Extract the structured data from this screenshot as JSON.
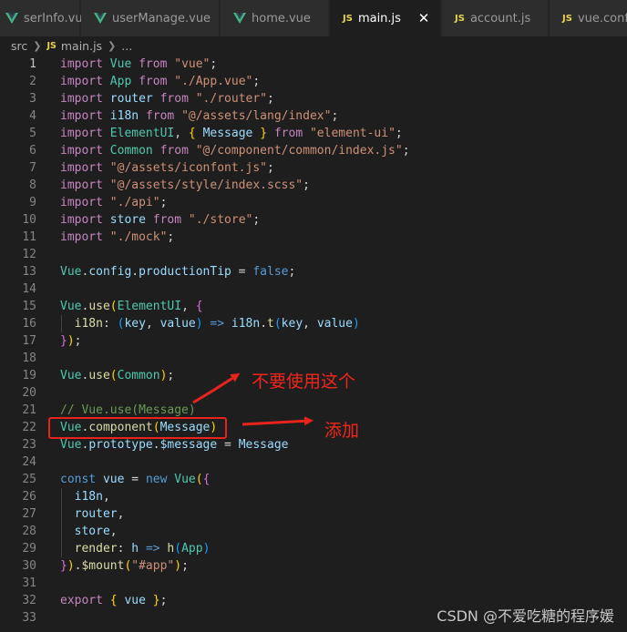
{
  "tabs": [
    {
      "label": "serInfo.vue",
      "icon": "vue-icon",
      "active": false
    },
    {
      "label": "userManage.vue",
      "icon": "vue-icon",
      "active": false
    },
    {
      "label": "home.vue",
      "icon": "vue-icon",
      "active": false
    },
    {
      "label": "main.js",
      "icon": "js-icon",
      "active": true
    },
    {
      "label": "account.js",
      "icon": "js-icon",
      "active": false
    },
    {
      "label": "vue.confi",
      "icon": "js-icon",
      "active": false
    }
  ],
  "js_badge": "JS",
  "close_glyph": "✕",
  "breadcrumb": {
    "folder": "src",
    "file": "main.js",
    "more": "..."
  },
  "line_numbers": [
    "1",
    "2",
    "3",
    "4",
    "5",
    "6",
    "7",
    "8",
    "9",
    "10",
    "11",
    "12",
    "13",
    "14",
    "15",
    "16",
    "17",
    "18",
    "19",
    "20",
    "21",
    "22",
    "23",
    "24",
    "25",
    "26",
    "27",
    "28",
    "29",
    "30",
    "31",
    "32",
    "33"
  ],
  "current_line": 1,
  "code_lines": [
    [
      [
        "kw",
        "import"
      ],
      [
        "pun",
        " "
      ],
      [
        "cls",
        "Vue"
      ],
      [
        "pun",
        " "
      ],
      [
        "kw",
        "from"
      ],
      [
        "pun",
        " "
      ],
      [
        "str",
        "\"vue\""
      ],
      [
        "pun",
        ";"
      ]
    ],
    [
      [
        "kw",
        "import"
      ],
      [
        "pun",
        " "
      ],
      [
        "cls",
        "App"
      ],
      [
        "pun",
        " "
      ],
      [
        "kw",
        "from"
      ],
      [
        "pun",
        " "
      ],
      [
        "str",
        "\"./App.vue\""
      ],
      [
        "pun",
        ";"
      ]
    ],
    [
      [
        "kw",
        "import"
      ],
      [
        "pun",
        " "
      ],
      [
        "ident",
        "router"
      ],
      [
        "pun",
        " "
      ],
      [
        "kw",
        "from"
      ],
      [
        "pun",
        " "
      ],
      [
        "str",
        "\"./router\""
      ],
      [
        "pun",
        ";"
      ]
    ],
    [
      [
        "kw",
        "import"
      ],
      [
        "pun",
        " "
      ],
      [
        "ident",
        "i18n"
      ],
      [
        "pun",
        " "
      ],
      [
        "kw",
        "from"
      ],
      [
        "pun",
        " "
      ],
      [
        "str",
        "\"@/assets/lang/index\""
      ],
      [
        "pun",
        ";"
      ]
    ],
    [
      [
        "kw",
        "import"
      ],
      [
        "pun",
        " "
      ],
      [
        "cls",
        "ElementUI"
      ],
      [
        "pun",
        ", "
      ],
      [
        "br1",
        "{"
      ],
      [
        "pun",
        " "
      ],
      [
        "ident",
        "Message"
      ],
      [
        "pun",
        " "
      ],
      [
        "br1",
        "}"
      ],
      [
        "pun",
        " "
      ],
      [
        "kw",
        "from"
      ],
      [
        "pun",
        " "
      ],
      [
        "str",
        "\"element-ui\""
      ],
      [
        "pun",
        ";"
      ]
    ],
    [
      [
        "kw",
        "import"
      ],
      [
        "pun",
        " "
      ],
      [
        "cls",
        "Common"
      ],
      [
        "pun",
        " "
      ],
      [
        "kw",
        "from"
      ],
      [
        "pun",
        " "
      ],
      [
        "str",
        "\"@/component/common/index.js\""
      ],
      [
        "pun",
        ";"
      ]
    ],
    [
      [
        "kw",
        "import"
      ],
      [
        "pun",
        " "
      ],
      [
        "str",
        "\"@/assets/iconfont.js\""
      ],
      [
        "pun",
        ";"
      ]
    ],
    [
      [
        "kw",
        "import"
      ],
      [
        "pun",
        " "
      ],
      [
        "str",
        "\"@/assets/style/index.scss\""
      ],
      [
        "pun",
        ";"
      ]
    ],
    [
      [
        "kw",
        "import"
      ],
      [
        "pun",
        " "
      ],
      [
        "str",
        "\"./api\""
      ],
      [
        "pun",
        ";"
      ]
    ],
    [
      [
        "kw",
        "import"
      ],
      [
        "pun",
        " "
      ],
      [
        "ident",
        "store"
      ],
      [
        "pun",
        " "
      ],
      [
        "kw",
        "from"
      ],
      [
        "pun",
        " "
      ],
      [
        "str",
        "\"./store\""
      ],
      [
        "pun",
        ";"
      ]
    ],
    [
      [
        "kw",
        "import"
      ],
      [
        "pun",
        " "
      ],
      [
        "str",
        "\"./mock\""
      ],
      [
        "pun",
        ";"
      ]
    ],
    [],
    [
      [
        "cls",
        "Vue"
      ],
      [
        "pun",
        "."
      ],
      [
        "ident",
        "config"
      ],
      [
        "pun",
        "."
      ],
      [
        "ident",
        "productionTip"
      ],
      [
        "pun",
        " = "
      ],
      [
        "const",
        "false"
      ],
      [
        "pun",
        ";"
      ]
    ],
    [],
    [
      [
        "cls",
        "Vue"
      ],
      [
        "pun",
        "."
      ],
      [
        "fn",
        "use"
      ],
      [
        "br1",
        "("
      ],
      [
        "cls",
        "ElementUI"
      ],
      [
        "pun",
        ", "
      ],
      [
        "br2",
        "{"
      ]
    ],
    [
      [
        "pun",
        "  "
      ],
      [
        "fn",
        "i18n"
      ],
      [
        "pun",
        ": "
      ],
      [
        "br3",
        "("
      ],
      [
        "ident",
        "key"
      ],
      [
        "pun",
        ", "
      ],
      [
        "ident",
        "value"
      ],
      [
        "br3",
        ")"
      ],
      [
        "pun",
        " "
      ],
      [
        "const",
        "=>"
      ],
      [
        "pun",
        " "
      ],
      [
        "ident",
        "i18n"
      ],
      [
        "pun",
        "."
      ],
      [
        "fn",
        "t"
      ],
      [
        "br3",
        "("
      ],
      [
        "ident",
        "key"
      ],
      [
        "pun",
        ", "
      ],
      [
        "ident",
        "value"
      ],
      [
        "br3",
        ")"
      ]
    ],
    [
      [
        "br2",
        "}"
      ],
      [
        "br1",
        ")"
      ],
      [
        "pun",
        ";"
      ]
    ],
    [],
    [
      [
        "cls",
        "Vue"
      ],
      [
        "pun",
        "."
      ],
      [
        "fn",
        "use"
      ],
      [
        "br1",
        "("
      ],
      [
        "cls",
        "Common"
      ],
      [
        "br1",
        ")"
      ],
      [
        "pun",
        ";"
      ]
    ],
    [],
    [
      [
        "cmt",
        "// Vue.use(Message)"
      ]
    ],
    [
      [
        "cls",
        "Vue"
      ],
      [
        "pun",
        "."
      ],
      [
        "fn",
        "component"
      ],
      [
        "br1",
        "("
      ],
      [
        "ident",
        "Message"
      ],
      [
        "br1",
        ")"
      ]
    ],
    [
      [
        "cls",
        "Vue"
      ],
      [
        "pun",
        "."
      ],
      [
        "ident",
        "prototype"
      ],
      [
        "pun",
        "."
      ],
      [
        "ident",
        "$message"
      ],
      [
        "pun",
        " = "
      ],
      [
        "ident",
        "Message"
      ]
    ],
    [],
    [
      [
        "const",
        "const"
      ],
      [
        "pun",
        " "
      ],
      [
        "ident",
        "vue"
      ],
      [
        "pun",
        " = "
      ],
      [
        "const",
        "new"
      ],
      [
        "pun",
        " "
      ],
      [
        "cls",
        "Vue"
      ],
      [
        "br1",
        "("
      ],
      [
        "br2",
        "{"
      ]
    ],
    [
      [
        "pun",
        "  "
      ],
      [
        "ident",
        "i18n"
      ],
      [
        "pun",
        ","
      ]
    ],
    [
      [
        "pun",
        "  "
      ],
      [
        "ident",
        "router"
      ],
      [
        "pun",
        ","
      ]
    ],
    [
      [
        "pun",
        "  "
      ],
      [
        "ident",
        "store"
      ],
      [
        "pun",
        ","
      ]
    ],
    [
      [
        "pun",
        "  "
      ],
      [
        "fn",
        "render"
      ],
      [
        "pun",
        ": "
      ],
      [
        "ident",
        "h"
      ],
      [
        "pun",
        " "
      ],
      [
        "const",
        "=>"
      ],
      [
        "pun",
        " "
      ],
      [
        "fn",
        "h"
      ],
      [
        "br3",
        "("
      ],
      [
        "cls",
        "App"
      ],
      [
        "br3",
        ")"
      ]
    ],
    [
      [
        "br2",
        "}"
      ],
      [
        "br1",
        ")"
      ],
      [
        "pun",
        "."
      ],
      [
        "fn",
        "$mount"
      ],
      [
        "br1",
        "("
      ],
      [
        "str",
        "\"#app\""
      ],
      [
        "br1",
        ")"
      ],
      [
        "pun",
        ";"
      ]
    ],
    [],
    [
      [
        "kw",
        "export"
      ],
      [
        "pun",
        " "
      ],
      [
        "br1",
        "{"
      ],
      [
        "pun",
        " "
      ],
      [
        "ident",
        "vue"
      ],
      [
        "pun",
        " "
      ],
      [
        "br1",
        "}"
      ],
      [
        "pun",
        ";"
      ]
    ],
    []
  ],
  "annotations": {
    "dont_use": "不要使用这个",
    "add": "添加",
    "color": "#e8231b"
  },
  "watermark": "CSDN @不爱吃糖的程序媛"
}
